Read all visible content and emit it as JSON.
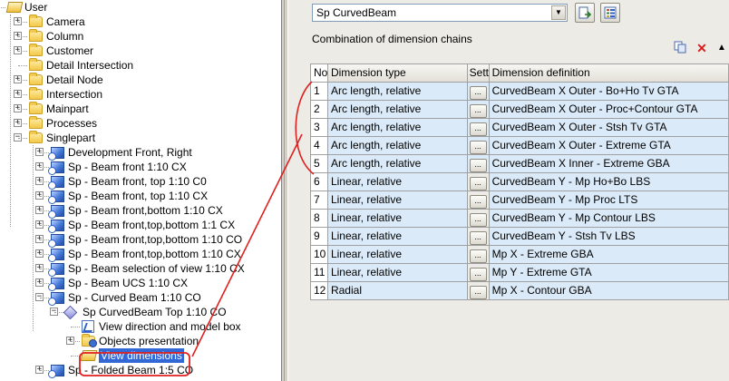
{
  "tree": {
    "nodes": [
      {
        "label": "User",
        "icon": "open-folder-icon",
        "expander": "−"
      },
      {
        "label": "Camera",
        "icon": "folder-icon",
        "expander": "+"
      },
      {
        "label": "Column",
        "icon": "folder-icon",
        "expander": "+"
      },
      {
        "label": "Customer",
        "icon": "folder-icon",
        "expander": "+"
      },
      {
        "label": "Detail Intersection",
        "icon": "folder-icon",
        "expander": ""
      },
      {
        "label": "Detail Node",
        "icon": "folder-icon",
        "expander": "+"
      },
      {
        "label": "Intersection",
        "icon": "folder-icon",
        "expander": "+"
      },
      {
        "label": "Mainpart",
        "icon": "folder-icon",
        "expander": "+"
      },
      {
        "label": "Processes",
        "icon": "folder-icon",
        "expander": "+"
      },
      {
        "label": "Singlepart",
        "icon": "folder-icon",
        "expander": "−"
      },
      {
        "label": "Development Front, Right",
        "icon": "beam-icon",
        "expander": "+"
      },
      {
        "label": "Sp - Beam front 1:10 CX",
        "icon": "beam-icon",
        "expander": "+"
      },
      {
        "label": "Sp - Beam front, top 1:10 C0",
        "icon": "beam-icon",
        "expander": "+"
      },
      {
        "label": "Sp - Beam front, top 1:10 CX",
        "icon": "beam-icon",
        "expander": "+"
      },
      {
        "label": "Sp - Beam front,bottom 1:10 CX",
        "icon": "beam-icon",
        "expander": "+"
      },
      {
        "label": "Sp - Beam front,top,bottom 1:1 CX",
        "icon": "beam-icon",
        "expander": "+"
      },
      {
        "label": "Sp - Beam front,top,bottom 1:10 CO",
        "icon": "beam-icon",
        "expander": "+"
      },
      {
        "label": "Sp - Beam front,top,bottom 1:10 CX",
        "icon": "beam-icon",
        "expander": "+"
      },
      {
        "label": "Sp - Beam selection of view 1:10 CX",
        "icon": "beam-icon",
        "expander": "+"
      },
      {
        "label": "Sp - Beam UCS 1:10 CX",
        "icon": "beam-icon",
        "expander": "+"
      },
      {
        "label": "Sp - Curved Beam 1:10 CO",
        "icon": "beam-icon",
        "expander": "−"
      },
      {
        "label": "Sp CurvedBeam Top 1:10 CO",
        "icon": "diamond-icon",
        "expander": "−"
      },
      {
        "label": "View direction and model box",
        "icon": "view-direction-icon",
        "expander": ""
      },
      {
        "label": "Objects presentation",
        "icon": "gear-icon",
        "expander": "+"
      },
      {
        "label": "View dimensions",
        "icon": "open-folder-icon",
        "expander": ""
      },
      {
        "label": "Sp - Folded Beam 1:5 CO",
        "icon": "beam-icon",
        "expander": "+"
      }
    ]
  },
  "panel": {
    "profile_selected": "Sp CurvedBeam",
    "section_title": "Combination of dimension chains",
    "columns": {
      "no": "No",
      "type": "Dimension type",
      "sett": "Sett",
      "def": "Dimension definition"
    },
    "settings_button_label": "...",
    "rows": [
      {
        "no": "1",
        "type": "Arc length, relative",
        "def": "CurvedBeam X Outer - Bo+Ho Tv GTA"
      },
      {
        "no": "2",
        "type": "Arc length, relative",
        "def": "CurvedBeam X Outer - Proc+Contour GTA"
      },
      {
        "no": "3",
        "type": "Arc length, relative",
        "def": "CurvedBeam X Outer - Stsh Tv GTA"
      },
      {
        "no": "4",
        "type": "Arc length, relative",
        "def": "CurvedBeam X Outer - Extreme GTA"
      },
      {
        "no": "5",
        "type": "Arc length, relative",
        "def": "CurvedBeam X Inner - Extreme GBA"
      },
      {
        "no": "6",
        "type": "Linear, relative",
        "def": "CurvedBeam Y - Mp Ho+Bo LBS"
      },
      {
        "no": "7",
        "type": "Linear, relative",
        "def": "CurvedBeam Y - Mp Proc LTS"
      },
      {
        "no": "8",
        "type": "Linear, relative",
        "def": "CurvedBeam Y - Mp Contour LBS"
      },
      {
        "no": "9",
        "type": "Linear, relative",
        "def": "CurvedBeam Y - Stsh Tv LBS"
      },
      {
        "no": "10",
        "type": "Linear, relative",
        "def": "Mp X - Extreme GBA"
      },
      {
        "no": "11",
        "type": "Linear, relative",
        "def": "Mp Y - Extreme GTA"
      },
      {
        "no": "12",
        "type": "Radial",
        "def": "Mp X - Contour GBA"
      }
    ]
  },
  "colors": {
    "annotation": "#e02020",
    "selection": "#3168d5",
    "row_highlight": "#dbeaf8",
    "panel_bg": "#ecebe5"
  }
}
